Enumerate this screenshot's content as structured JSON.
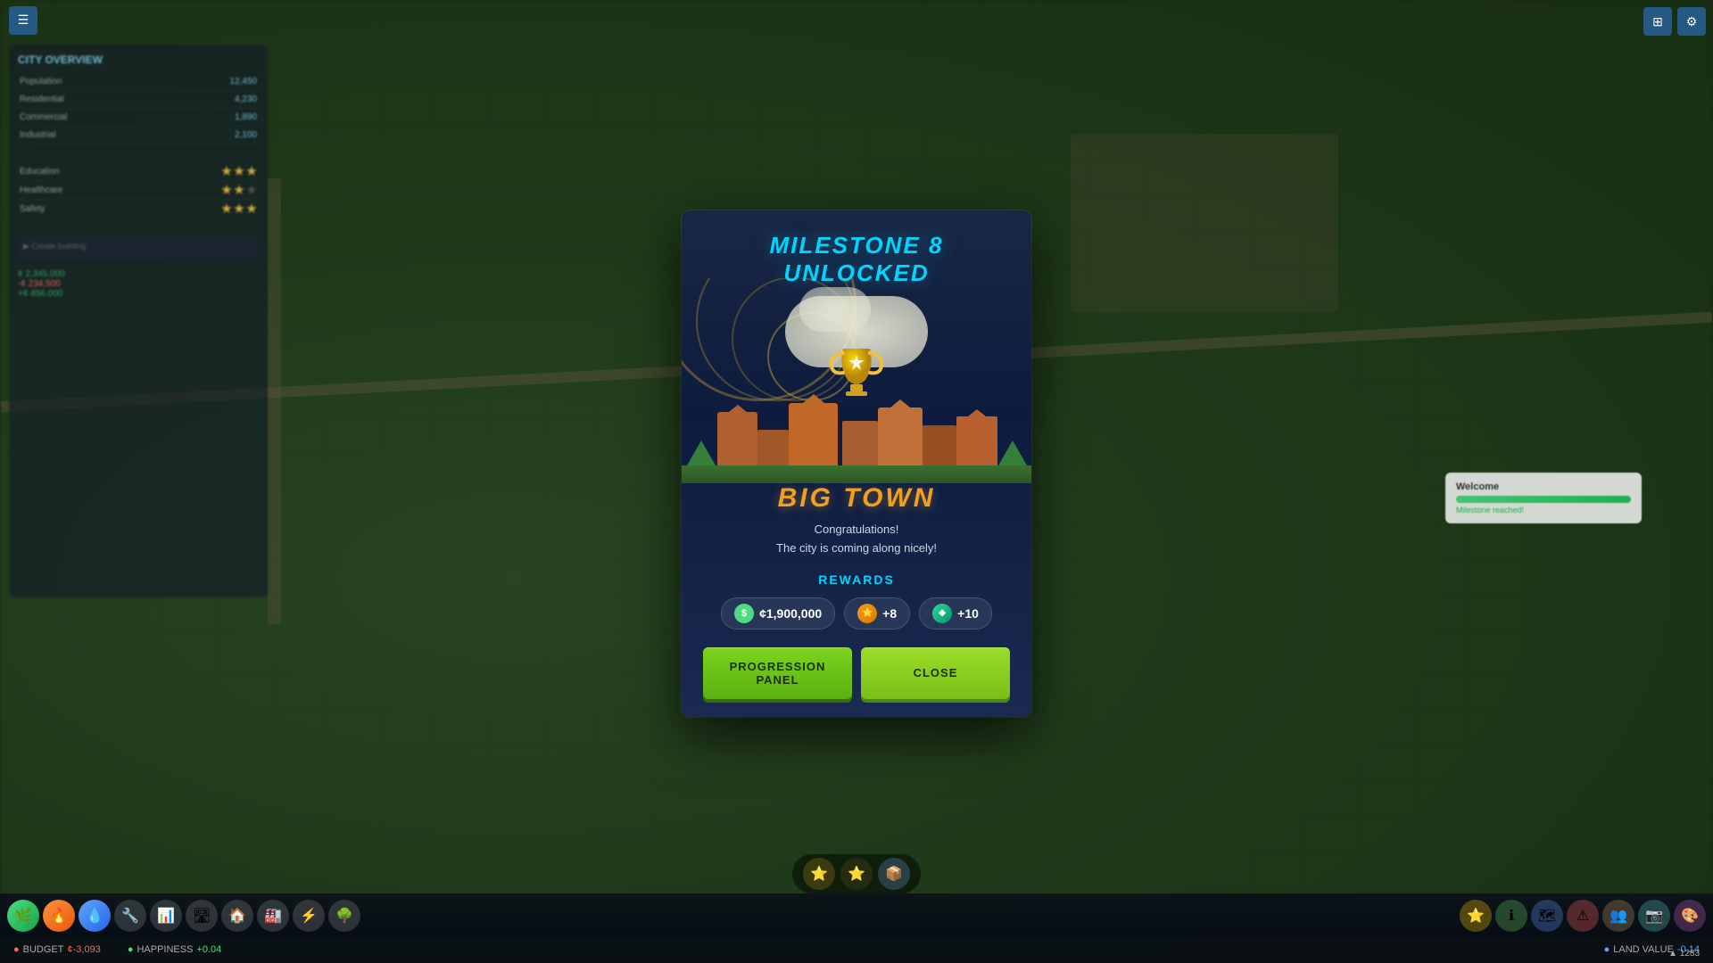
{
  "modal": {
    "milestone_title": "MILESTONE 8",
    "milestone_subtitle": "UNLOCKED",
    "town_name": "BIG TOWN",
    "congrats_line1": "Congratulations!",
    "congrats_line2": "The city is coming along nicely!",
    "rewards_label": "REWARDS",
    "reward_money": "¢1,900,000",
    "reward_xp_label": "+8",
    "reward_pts_label": "+10",
    "btn_progression": "PROGRESSION PANEL",
    "btn_close": "CLOSE"
  },
  "top_bar": {
    "left_icon": "☰",
    "right_icon1": "⊞",
    "right_icon2": "⚙"
  },
  "status_bar": {
    "population": "¢-3,093",
    "happiness": "+0.04",
    "budget": "-0.14",
    "label1": "BUDGET",
    "label2": "HAPPINESS",
    "label3": "LAND VALUE"
  },
  "milestone_bar": {
    "icons": [
      "⭐",
      "⭐",
      "📦"
    ]
  },
  "notification": {
    "title": "Welcome",
    "subtitle": "Milestone reached!"
  }
}
